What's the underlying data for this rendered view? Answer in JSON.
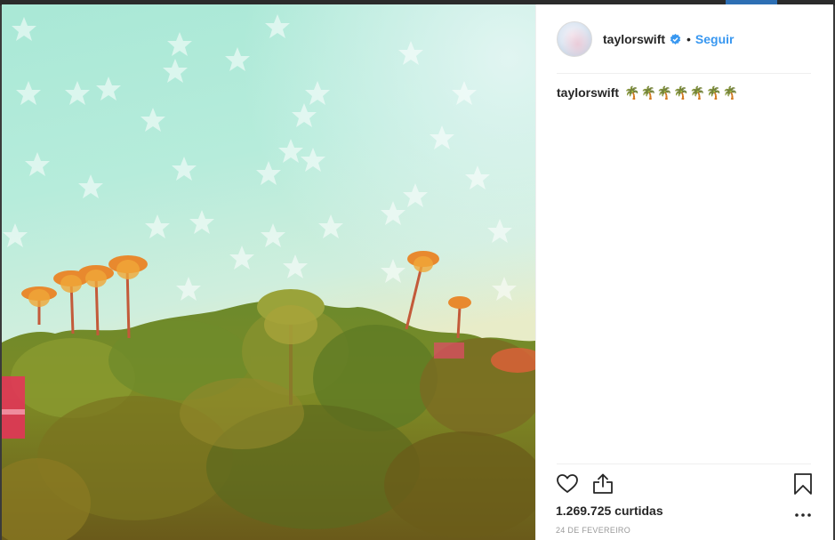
{
  "post": {
    "username": "taylorswift",
    "dot": "•",
    "follow_label": "Seguir",
    "caption_user": "taylorswift",
    "caption_text": "🌴🌴🌴🌴🌴🌴🌴",
    "views": "1.269.725 curtidas",
    "date": "24 DE FEVEREIRO"
  },
  "icons": {
    "verified": "verified-badge-icon",
    "like": "heart-icon",
    "share": "share-icon",
    "save": "bookmark-icon",
    "more": "more-options-icon"
  },
  "colors": {
    "link": "#3897f0",
    "text": "#262626",
    "muted": "#999999",
    "divider": "#efefef"
  }
}
